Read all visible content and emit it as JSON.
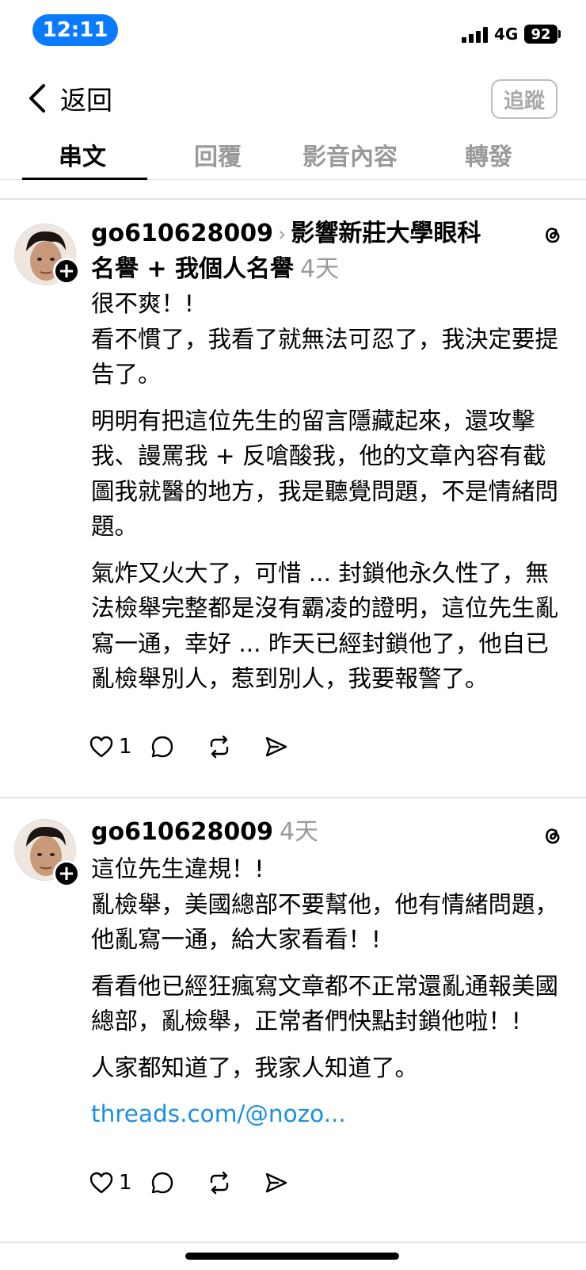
{
  "status_bar": {
    "time": "12:11",
    "network": "4G",
    "battery": "92"
  },
  "header": {
    "back_label": "返回",
    "follow_label": "追蹤"
  },
  "tabs": [
    {
      "label": "串文"
    },
    {
      "label": "回覆"
    },
    {
      "label": "影音內容"
    },
    {
      "label": "轉發"
    }
  ],
  "posts": [
    {
      "username": "go610628009",
      "topic": "影響新莊大學眼科名譽 + 我個人名譽",
      "age": "4天",
      "paragraphs": [
        "很不爽！!\n看不慣了，我看了就無法可忍了，我決定要提告了。",
        "明明有把這位先生的留言隱藏起來，還攻擊我、謾罵我 + 反嗆酸我，他的文章內容有截圖我就醫的地方，我是聽覺問題，不是情緒問題。",
        "氣炸又火大了，可惜 ... 封鎖他永久性了，無法檢舉完整都是沒有霸凌的證明，這位先生亂寫一通，幸好 ... 昨天已經封鎖他了，他自已亂檢舉別人，惹到別人，我要報警了。"
      ],
      "likes": "1"
    },
    {
      "username": "go610628009",
      "age": "4天",
      "paragraphs": [
        "這位先生違規！!\n亂檢舉，美國總部不要幫他，他有情緒問題，他亂寫一通，給大家看看！!",
        "看看他已經狂瘋寫文章都不正常還亂通報美國總部，亂檢舉，正常者們快點封鎖他啦！!",
        "人家都知道了，我家人知道了。"
      ],
      "link": "threads.com/@nozo...",
      "likes": "1"
    }
  ],
  "icons": {
    "back": "chevron-left-icon",
    "threads": "threads-logo-icon",
    "like": "heart-icon",
    "comment": "comment-icon",
    "repost": "repost-icon",
    "share": "send-icon",
    "follow_badge": "plus-icon"
  },
  "colors": {
    "time_pill": "#0a7aff",
    "link": "#1a8fe3",
    "muted": "#9a9a9a"
  }
}
